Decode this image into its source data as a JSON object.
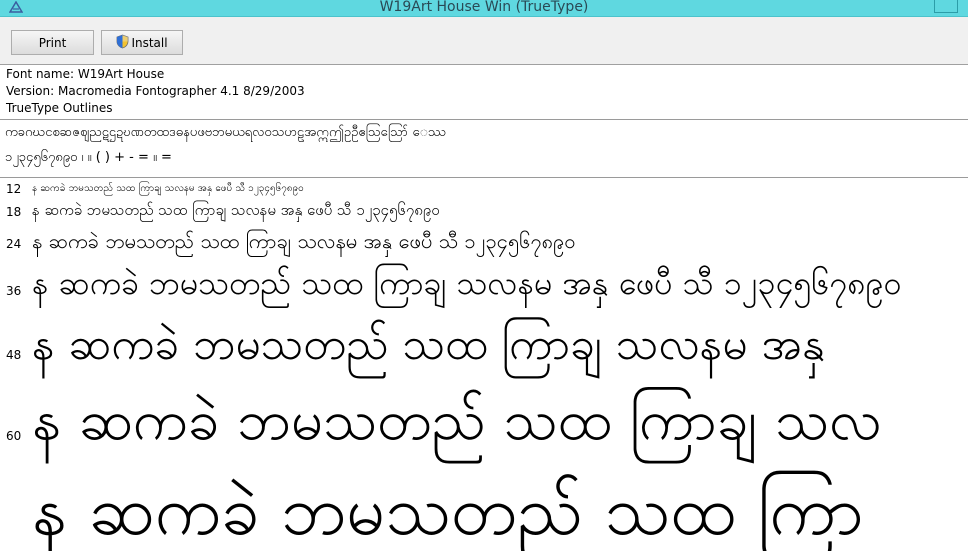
{
  "window": {
    "title": "W19Art House  Win (TrueType)"
  },
  "toolbar": {
    "print_label": "Print",
    "install_label": "Install"
  },
  "info": {
    "font_name": "Font name: W19Art House",
    "version": "Version: Macromedia Fontographer 4.1 8/29/2003",
    "outlines": "TrueType Outlines"
  },
  "charset": {
    "line1": "ကခဂဃငစဆဇဈညဋဌဍဎဏတထဒဓနပဖဗဘမယရလဝသဟဠအဣဤဥဦဧဩဪ ေဿ",
    "line2": "၁၂၃၄၅၆၇၈၉၀ ၊ ။ ( ) + - = ။ ="
  },
  "samples": [
    {
      "size": "12",
      "text": "န ဆကခဲ ဘမသတည် သထ ကြာချ သလနမ အနှ ဖေပီ သီ ၁၂၃၄၅၆၇၈၉၀"
    },
    {
      "size": "18",
      "text": "န ဆကခဲ ဘမသတည် သထ ကြာချ သလနမ အနှ ဖေပီ သီ ၁၂၃၄၅၆၇၈၉၀"
    },
    {
      "size": "24",
      "text": "န ဆကခဲ ဘမသတည် သထ ကြာချ သလနမ အနှ ဖေပီ သီ ၁၂၃၄၅၆၇၈၉၀"
    },
    {
      "size": "36",
      "text": "န ဆကခဲ ဘမသတည် သထ ကြာချ သလနမ အနှ ဖေပီ သီ ၁၂၃၄၅၆၇၈၉၀"
    },
    {
      "size": "48",
      "text": "န ဆကခဲ ဘမသတည် သထ ကြာချ သလနမ အနှ"
    },
    {
      "size": "60",
      "text": "န ဆကခဲ ဘမသတည် သထ ကြာချ သလ"
    },
    {
      "size": "",
      "text": "န ဆကခဲ ဘမသတည် သထ ကြာ"
    }
  ]
}
